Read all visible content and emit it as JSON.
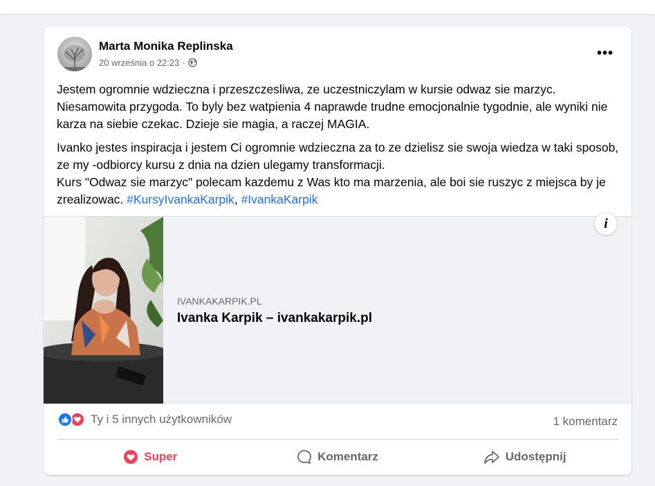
{
  "post": {
    "author": "Marta Monika Replinska",
    "timestamp": "20 września o 22:23",
    "separator": "·",
    "privacy_icon": "globe-icon",
    "more_label": "•••",
    "paragraph1": "Jestem ogromnie wdzieczna i przeszczesliwa, ze uczestniczylam w kursie odwaz sie marzyc. Niesamowita przygoda. To byly bez watpienia 4 naprawde trudne emocjonalnie tygodnie, ale wyniki nie karza na siebie czekac. Dzieje sie magia, a raczej MAGIA.",
    "paragraph2_line1": "Ivanko jestes inspiracja i jestem Ci ogromnie wdzieczna za to ze dzielisz sie swoja wiedza w taki sposob, ze my -odbiorcy kursu z dnia na dzien ulegamy transformacji.",
    "paragraph2_line2": "Kurs \"Odwaz sie marzyc\" polecam kazdemu z Was kto ma marzenia, ale boi sie ruszyc z miejsca by je zrealizowac.",
    "hashtag1": "#KursyIvankaKarpik",
    "hashtag_sep": ",",
    "hashtag2": "#IvankaKarpik"
  },
  "link_card": {
    "domain": "IVANKAKARPIK.PL",
    "title": "Ivanka Karpik – ivankakarpik.pl",
    "info_label": "i"
  },
  "reactions": {
    "icons": [
      "like-icon",
      "love-icon"
    ],
    "text": "Ty i 5 innych użytkowników",
    "comments": "1 komentarz"
  },
  "actions": {
    "super": "Super",
    "comment": "Komentarz",
    "share": "Udostępnij"
  },
  "colors": {
    "background": "#f0f2f5",
    "card": "#ffffff",
    "hashtag": "#216fdb",
    "like": "#1877f2",
    "love": "#f33e58",
    "secondary_text": "#65676b"
  }
}
